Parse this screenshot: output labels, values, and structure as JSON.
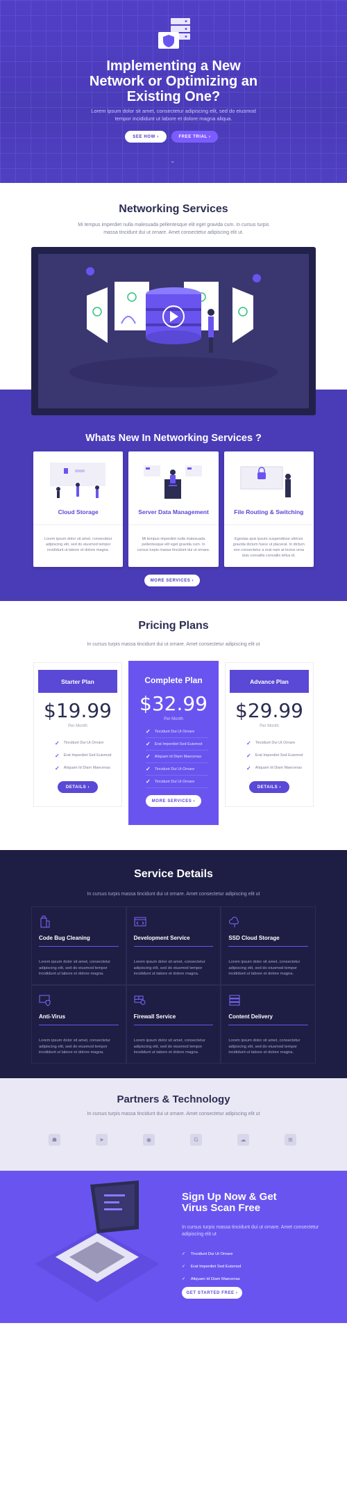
{
  "hero": {
    "title_lines": [
      "Implementing a New",
      "Network or Optimizing an",
      "Existing One?"
    ],
    "description": "Lorem ipsum dolor sit amet, consectetur adipiscing elit, sed do eiusmod tempor incididunt ut labore et dolore magna aliqua.",
    "see_how_label": "SEE HOW ›",
    "free_trial_label": "FREE TRIAL ›",
    "scroll_glyph": "⌄"
  },
  "networking": {
    "title": "Networking Services",
    "subtitle": "Mi tempus imperdiet nulla malesuada pellentesque elit eget gravida cum. In cursus turpis massa tincidunt dui ut ornare. Amet consectetur adipiscing elit ut."
  },
  "whats_new": {
    "title": "Whats New In Networking Services ?",
    "cards": [
      {
        "title": "Cloud Storage",
        "desc": "Lorem ipsum dolor sit amet, consectetur adipiscing elit, sed do eiusmod tempor incididunt ut labore et dolore magna."
      },
      {
        "title": "Server Data Management",
        "desc": "Mi tempus imperdiet nulla malesuada pellentesque elit eget gravida cum. In cursus turpis massa tincidunt dui ut ornare."
      },
      {
        "title": "File Routing & Switching",
        "desc": "Egestas quis ipsum suspendisse ultrices gravida dictum fusce ut placerat. In dictum non consectetur a erat nam at lectus urna duis convallis convallis tellus id."
      }
    ],
    "more_label": "MORE SERVICES ›"
  },
  "pricing": {
    "title": "Pricing Plans",
    "subtitle": "In cursus turpis massa tincidunt dui ut ornare. Amet consectetur adipiscing elit ut",
    "plans": [
      {
        "name": "Starter Plan",
        "price": "$19.99",
        "period": "Per Month",
        "features": [
          "Tincidunt Dui Ut Ornare",
          "Erat Imperdiet Sed Euismod",
          "Aliquam Id Diam Maecenas"
        ],
        "button": "DETAILS ›"
      },
      {
        "name": "Complete Plan",
        "price": "$32.99",
        "period": "Per Month",
        "features": [
          "Tincidunt Dui Ut Ornare",
          "Erat Imperdiet Sed Euismod",
          "Aliquam Id Diam Maecenas",
          "Tincidunt Dui Ut Ornare",
          "Tincidunt Dui Ut Ornare"
        ],
        "button": "MORE SERVICES ›"
      },
      {
        "name": "Advance Plan",
        "price": "$29.99",
        "period": "Per Month",
        "features": [
          "Tincidunt Dui Ut Ornare",
          "Erat Imperdiet Sed Euismod",
          "Aliquam Id Diam Maecenas"
        ],
        "button": "DETAILS ›"
      }
    ]
  },
  "service_details": {
    "title": "Service Details",
    "subtitle": "In cursus turpis massa tincidunt dui ut ornare. Amet consectetur adipiscing elit ut",
    "items": [
      {
        "name": "Code Bug Cleaning",
        "icon": "building-icon",
        "desc": "Lorem ipsum dolor sit amet, consectetur adipiscing elit, sed do eiusmod tempor incididunt ut labore et dolore magna."
      },
      {
        "name": "Development Service",
        "icon": "code-window-icon",
        "desc": "Lorem ipsum dolor sit amet, consectetur adipiscing elit, sed do eiusmod tempor incididunt ut labore et dolore magna."
      },
      {
        "name": "SSD Cloud Storage",
        "icon": "cloud-icon",
        "desc": "Lorem ipsum dolor sit amet, consectetur adipiscing elit, sed do eiusmod tempor incididunt ut labore et dolore magna."
      },
      {
        "name": "Anti-Virus",
        "icon": "monitor-shield-icon",
        "desc": "Lorem ipsum dolor sit amet, consectetur adipiscing elit, sed do eiusmod tempor incididunt ut labore et dolore magna."
      },
      {
        "name": "Firewall Service",
        "icon": "firewall-icon",
        "desc": "Lorem ipsum dolor sit amet, consectetur adipiscing elit, sed do eiusmod tempor incididunt ut labore et dolore magna."
      },
      {
        "name": "Content Delivery",
        "icon": "server-rack-icon",
        "desc": "Lorem ipsum dolor sit amet, consectetur adipiscing elit, sed do eiusmod tempor incididunt ut labore et dolore magna."
      }
    ]
  },
  "partners": {
    "title": "Partners & Technology",
    "subtitle": "In cursus turpis massa tincidunt dui ut ornare. Amet consectetur adipiscing elit ut",
    "logos": [
      {
        "name": "android-logo-icon",
        "glyph": "☗"
      },
      {
        "name": "paper-plane-logo-icon",
        "glyph": "➤"
      },
      {
        "name": "chrome-logo-icon",
        "glyph": "◉"
      },
      {
        "name": "google-logo-icon",
        "glyph": "G"
      },
      {
        "name": "cloud-logo-icon",
        "glyph": "☁"
      },
      {
        "name": "windows-logo-icon",
        "glyph": "⊞"
      }
    ]
  },
  "signup": {
    "title_lines": [
      "Sign Up Now & Get",
      "Virus Scan Free"
    ],
    "description": "In cursus turpis massa tincidunt dui ut ornare. Amet consectetur adipiscing elit ut",
    "features": [
      "Tincidunt Dui Ut Ornare",
      "Erat Imperdiet Sed Euismod",
      "Aliquam Id Diam Maecenas"
    ],
    "button": "GET STARTED FREE ›"
  },
  "colors": {
    "brand": "#4a3bb7",
    "accent": "#6a54f0",
    "dark": "#1e1d43",
    "heading": "#2b2d52"
  }
}
